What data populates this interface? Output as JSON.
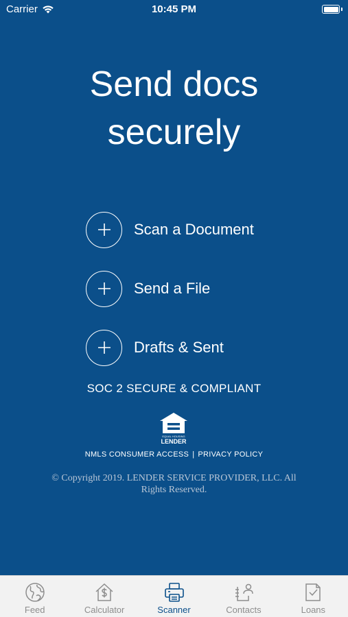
{
  "status_bar": {
    "carrier": "Carrier",
    "time": "10:45 PM"
  },
  "main": {
    "headline_line1": "Send docs",
    "headline_line2": "securely",
    "actions": [
      {
        "label": "Scan a Document",
        "icon": "plus-icon"
      },
      {
        "label": "Send a File",
        "icon": "plus-icon"
      },
      {
        "label": "Drafts & Sent",
        "icon": "plus-icon"
      }
    ],
    "compliance": "SOC 2 SECURE & COMPLIANT",
    "logo_text_small": "EQUAL HOUSING",
    "logo_text_large": "LENDER",
    "links": {
      "nmls": "NMLS CONSUMER ACCESS",
      "separator": "|",
      "privacy": "PRIVACY POLICY"
    },
    "copyright": "© Copyright 2019. LENDER SERVICE PROVIDER, LLC. All Rights Reserved."
  },
  "tab_bar": {
    "active": "Scanner",
    "tabs": [
      {
        "label": "Feed",
        "icon": "globe-icon"
      },
      {
        "label": "Calculator",
        "icon": "house-dollar-icon"
      },
      {
        "label": "Scanner",
        "icon": "printer-icon"
      },
      {
        "label": "Contacts",
        "icon": "contacts-icon"
      },
      {
        "label": "Loans",
        "icon": "document-check-icon"
      }
    ]
  },
  "colors": {
    "background": "#0b4f8a",
    "tab_bar_bg": "#f2f2f2",
    "tab_inactive": "#8d8d8d",
    "tab_active": "#0b4f8a"
  }
}
